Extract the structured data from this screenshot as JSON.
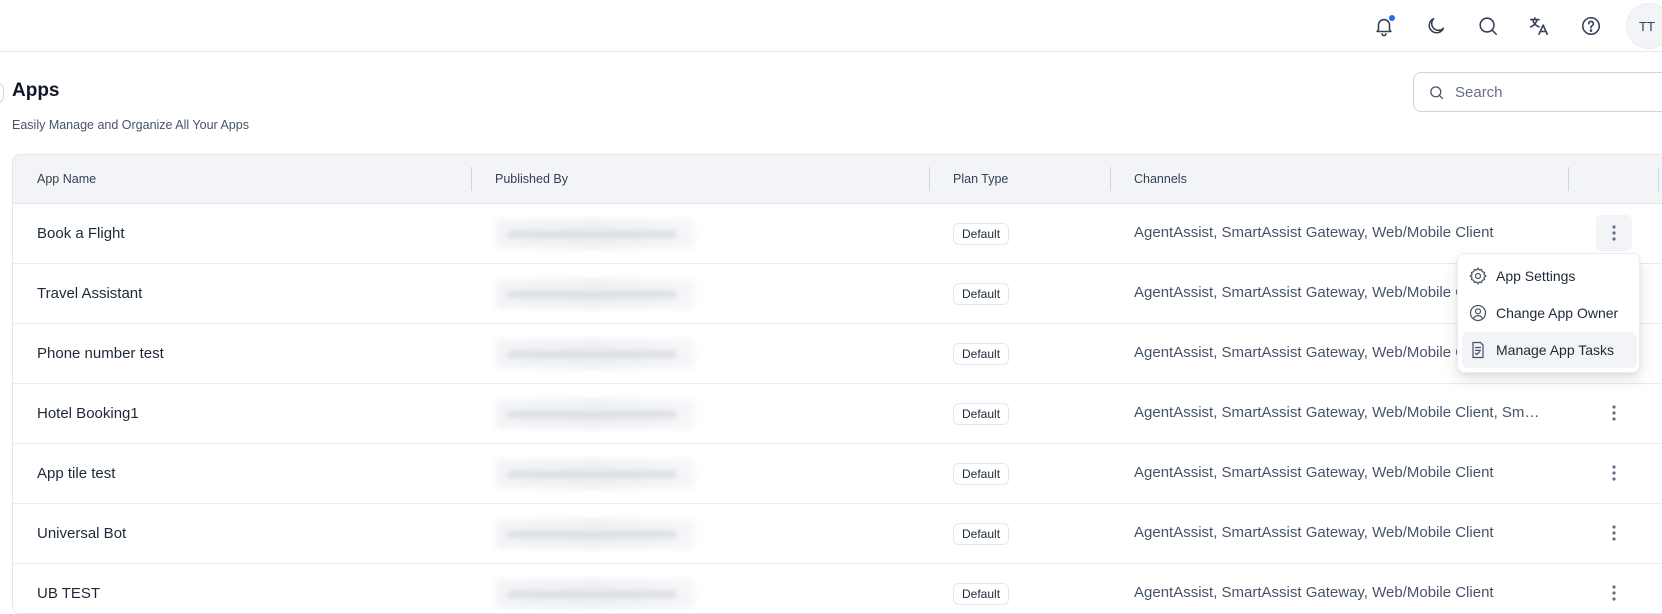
{
  "header": {
    "avatar_initials": "TT",
    "icons": [
      "bell-icon",
      "moon-icon",
      "search-icon",
      "translate-icon",
      "help-icon"
    ],
    "notification_dot_color": "#1d6bf3"
  },
  "page": {
    "title": "Apps",
    "subtitle": "Easily Manage and Organize All Your Apps",
    "search_placeholder": "Search"
  },
  "table": {
    "columns": [
      "App Name",
      "Published By",
      "Plan Type",
      "Channels",
      ""
    ],
    "rows": [
      {
        "name": "Book a Flight",
        "plan": "Default",
        "channels": "AgentAssist, SmartAssist Gateway, Web/Mobile Client"
      },
      {
        "name": "Travel Assistant",
        "plan": "Default",
        "channels": "AgentAssist, SmartAssist Gateway, Web/Mobile C"
      },
      {
        "name": "Phone number test",
        "plan": "Default",
        "channels": "AgentAssist, SmartAssist Gateway, Web/Mobile C"
      },
      {
        "name": "Hotel Booking1",
        "plan": "Default",
        "channels": "AgentAssist, SmartAssist Gateway, Web/Mobile Client, Smar..."
      },
      {
        "name": "App tile test",
        "plan": "Default",
        "channels": "AgentAssist, SmartAssist Gateway, Web/Mobile Client"
      },
      {
        "name": "Universal Bot",
        "plan": "Default",
        "channels": "AgentAssist, SmartAssist Gateway, Web/Mobile Client"
      },
      {
        "name": "UB TEST",
        "plan": "Default",
        "channels": "AgentAssist, SmartAssist Gateway, Web/Mobile Client"
      }
    ]
  },
  "row_menu": {
    "items": [
      {
        "label": "App Settings",
        "icon": "gear-icon"
      },
      {
        "label": "Change App Owner",
        "icon": "user-circle-icon"
      },
      {
        "label": "Manage App Tasks",
        "icon": "document-check-icon"
      }
    ]
  }
}
